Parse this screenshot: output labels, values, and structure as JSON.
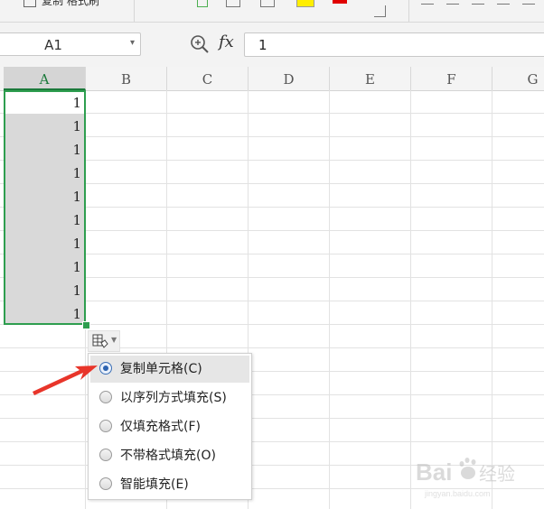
{
  "ribbon": {
    "format_painter_label": "复制 格式刷"
  },
  "formula_bar": {
    "name_box": "A1",
    "fx_label": "fx",
    "formula_value": "1"
  },
  "sheet": {
    "columns": [
      "A",
      "B",
      "C",
      "D",
      "E",
      "F",
      "G"
    ],
    "selected_column": "A",
    "cells_a": [
      "1",
      "1",
      "1",
      "1",
      "1",
      "1",
      "1",
      "1",
      "1",
      "1"
    ]
  },
  "autofill_menu": {
    "options": [
      {
        "label": "复制单元格(C)",
        "selected": true
      },
      {
        "label": "以序列方式填充(S)",
        "selected": false
      },
      {
        "label": "仅填充格式(F)",
        "selected": false
      },
      {
        "label": "不带格式填充(O)",
        "selected": false
      },
      {
        "label": "智能填充(E)",
        "selected": false
      }
    ]
  },
  "annotation": {
    "arrow_color": "#e8352a"
  },
  "watermark": {
    "text": "Baidu经验"
  },
  "colors": {
    "selection_border": "#2e9e4f",
    "radio_selected": "#2d63b0"
  }
}
